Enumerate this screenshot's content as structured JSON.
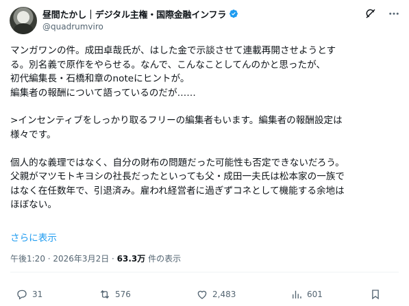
{
  "author": {
    "display_name": "昼間たかし｜デジタル主権・国際金融インフラ",
    "handle": "@quadrumviro",
    "verified_color": "#1d9bf0"
  },
  "post": {
    "lines": [
      "マンガワンの件。成田卓哉氏が、はした金で示談させて連載再開させようとす",
      "る。別名義で原作をやらせる。なんで、こんなことしてんのかと思ったが、",
      "初代編集長・石橋和章のnoteにヒントが。",
      "編集者の報酬について語っているのだが……",
      "",
      ">インセンティブをしっかり取るフリーの編集者もいます。編集者の報酬設定は",
      "様々です。",
      "",
      "個人的な義理ではなく、自分の財布の問題だった可能性も否定できないだろう。",
      "父親がマツモトキヨシの社長だったといっても父・成田一夫氏は松本家の一族で",
      "はなく在任数年で、引退済み。雇われ経営者に過ぎずコネとして機能する余地は",
      "ほぼない。"
    ],
    "show_more": "さらに表示",
    "time": "午後1:20 · 2026年3月2日 · ",
    "views_count": "63.3万",
    "views_label": " 件の表示"
  },
  "stats": {
    "replies": "31",
    "reposts": "576",
    "likes": "2,483",
    "views": "601"
  },
  "icons": {
    "grok": "grok-icon",
    "more": "more-icon",
    "reply": "reply-icon",
    "repost": "repost-icon",
    "like": "heart-icon",
    "views": "views-icon",
    "bookmark": "bookmark-icon"
  },
  "colors": {
    "text": "#0f1419",
    "secondary": "#536471",
    "link": "#1d9bf0"
  }
}
